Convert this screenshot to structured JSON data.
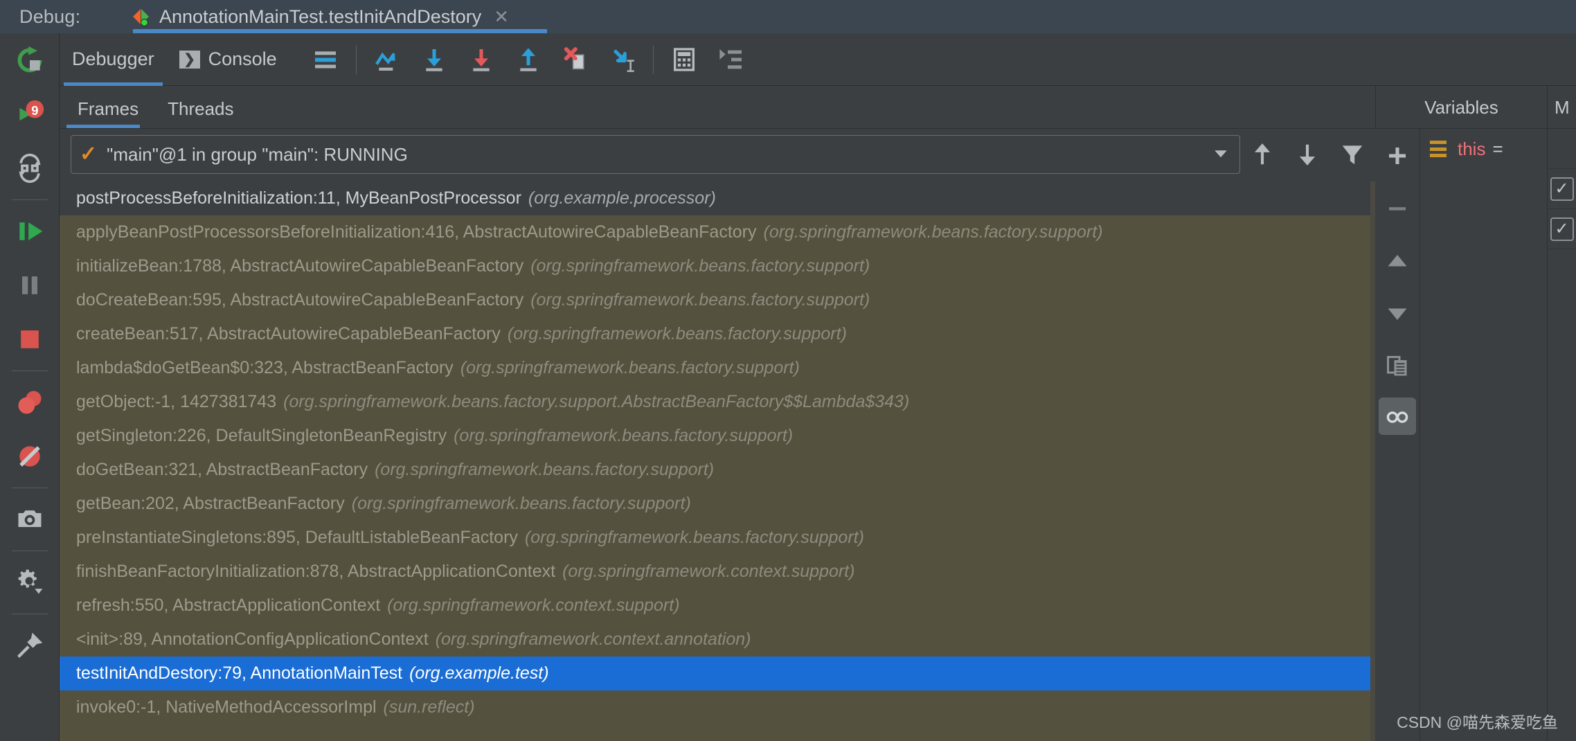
{
  "titlebar": {
    "label": "Debug:",
    "tab_title": "AnnotationMainTest.testInitAndDestory",
    "close": "✕",
    "tab_icon": "run-test-icon"
  },
  "rail": {
    "items": [
      {
        "name": "rerun-icon",
        "label": ""
      },
      {
        "name": "stop-and-rerun-breakpoint-icon",
        "label": ""
      },
      {
        "name": "restore-layout-icon",
        "label": ""
      },
      {
        "name": "resume-program-icon",
        "label": ""
      },
      {
        "name": "pause-program-icon",
        "label": ""
      },
      {
        "name": "stop-icon",
        "label": ""
      },
      {
        "name": "view-breakpoints-icon",
        "label": ""
      },
      {
        "name": "mute-breakpoints-icon",
        "label": ""
      },
      {
        "name": "camera-icon",
        "label": ""
      },
      {
        "name": "settings-gear-icon",
        "label": ""
      },
      {
        "name": "pin-tab-icon",
        "label": ""
      }
    ]
  },
  "toolbar": {
    "tabs": [
      {
        "label": "Debugger",
        "active": true,
        "icon": null
      },
      {
        "label": "Console",
        "active": false,
        "icon": "console-icon"
      }
    ],
    "buttons": [
      {
        "name": "layout-settings-icon",
        "title": "Layout Settings"
      },
      {
        "name": "step-over-icon",
        "title": "Step Over"
      },
      {
        "name": "step-into-icon",
        "title": "Step Into"
      },
      {
        "name": "force-step-into-icon",
        "title": "Force Step Into"
      },
      {
        "name": "step-out-icon",
        "title": "Step Out"
      },
      {
        "name": "drop-frame-icon",
        "title": "Drop Frame"
      },
      {
        "name": "run-to-cursor-icon",
        "title": "Run to Cursor"
      },
      {
        "name": "evaluate-expression-icon",
        "title": "Evaluate Expression"
      },
      {
        "name": "show-execution-point-icon",
        "title": "Show Execution Point"
      }
    ]
  },
  "subtabs": [
    {
      "label": "Frames",
      "active": true
    },
    {
      "label": "Threads",
      "active": false
    }
  ],
  "thread_selector": {
    "value": "\"main\"@1 in group \"main\": RUNNING",
    "status_icon": "check-icon",
    "dropdown_icon": "chevron-down-icon",
    "buttons": [
      {
        "name": "move-up-icon",
        "title": "Up"
      },
      {
        "name": "move-down-icon",
        "title": "Down"
      },
      {
        "name": "filter-icon",
        "title": "Filter"
      }
    ]
  },
  "frames": [
    {
      "method": "postProcessBeforeInitialization:11, MyBeanPostProcessor",
      "pkg": "(org.example.processor)",
      "state": "current"
    },
    {
      "method": "applyBeanPostProcessorsBeforeInitialization:416, AbstractAutowireCapableBeanFactory",
      "pkg": "(org.springframework.beans.factory.support)",
      "state": "library"
    },
    {
      "method": "initializeBean:1788, AbstractAutowireCapableBeanFactory",
      "pkg": "(org.springframework.beans.factory.support)",
      "state": "library"
    },
    {
      "method": "doCreateBean:595, AbstractAutowireCapableBeanFactory",
      "pkg": "(org.springframework.beans.factory.support)",
      "state": "library"
    },
    {
      "method": "createBean:517, AbstractAutowireCapableBeanFactory",
      "pkg": "(org.springframework.beans.factory.support)",
      "state": "library"
    },
    {
      "method": "lambda$doGetBean$0:323, AbstractBeanFactory",
      "pkg": "(org.springframework.beans.factory.support)",
      "state": "library"
    },
    {
      "method": "getObject:-1, 1427381743",
      "pkg": "(org.springframework.beans.factory.support.AbstractBeanFactory$$Lambda$343)",
      "state": "library"
    },
    {
      "method": "getSingleton:226, DefaultSingletonBeanRegistry",
      "pkg": "(org.springframework.beans.factory.support)",
      "state": "library"
    },
    {
      "method": "doGetBean:321, AbstractBeanFactory",
      "pkg": "(org.springframework.beans.factory.support)",
      "state": "library"
    },
    {
      "method": "getBean:202, AbstractBeanFactory",
      "pkg": "(org.springframework.beans.factory.support)",
      "state": "library"
    },
    {
      "method": "preInstantiateSingletons:895, DefaultListableBeanFactory",
      "pkg": "(org.springframework.beans.factory.support)",
      "state": "library"
    },
    {
      "method": "finishBeanFactoryInitialization:878, AbstractApplicationContext",
      "pkg": "(org.springframework.context.support)",
      "state": "library"
    },
    {
      "method": "refresh:550, AbstractApplicationContext",
      "pkg": "(org.springframework.context.support)",
      "state": "library"
    },
    {
      "method": "<init>:89, AnnotationConfigApplicationContext",
      "pkg": "(org.springframework.context.annotation)",
      "state": "library"
    },
    {
      "method": "testInitAndDestory:79, AnnotationMainTest",
      "pkg": "(org.example.test)",
      "state": "selected"
    },
    {
      "method": "invoke0:-1, NativeMethodAccessorImpl",
      "pkg": "(sun.reflect)",
      "state": "library"
    }
  ],
  "right_panel": {
    "headers": [
      {
        "label": "Variables"
      },
      {
        "label": "M"
      }
    ],
    "buttons": [
      {
        "name": "add-watch-icon",
        "glyph": "+"
      },
      {
        "name": "remove-watch-icon",
        "glyph": "−"
      },
      {
        "name": "move-watch-up-icon",
        "glyph": "▲"
      },
      {
        "name": "move-watch-down-icon",
        "glyph": "▼"
      },
      {
        "name": "copy-value-icon",
        "glyph": "copy"
      },
      {
        "name": "inspect-watches-icon",
        "glyph": "glasses",
        "toggled": true
      }
    ],
    "variables": [
      {
        "name": "this",
        "equals": "="
      }
    ],
    "m_column": [
      {
        "checked": false,
        "empty": true
      },
      {
        "checked": true
      },
      {
        "checked": true
      }
    ]
  },
  "watermark": "CSDN @喵先森爱吃鱼",
  "colors": {
    "titlebar_bg": "#3c4650",
    "panel_bg": "#3c3f41",
    "frames_library_bg": "#55513f",
    "selected_row_bg": "#1a6dd4",
    "accent_blue": "#4a88c7",
    "variable_name": "#f07178",
    "variable_icon": "#c8922a"
  }
}
